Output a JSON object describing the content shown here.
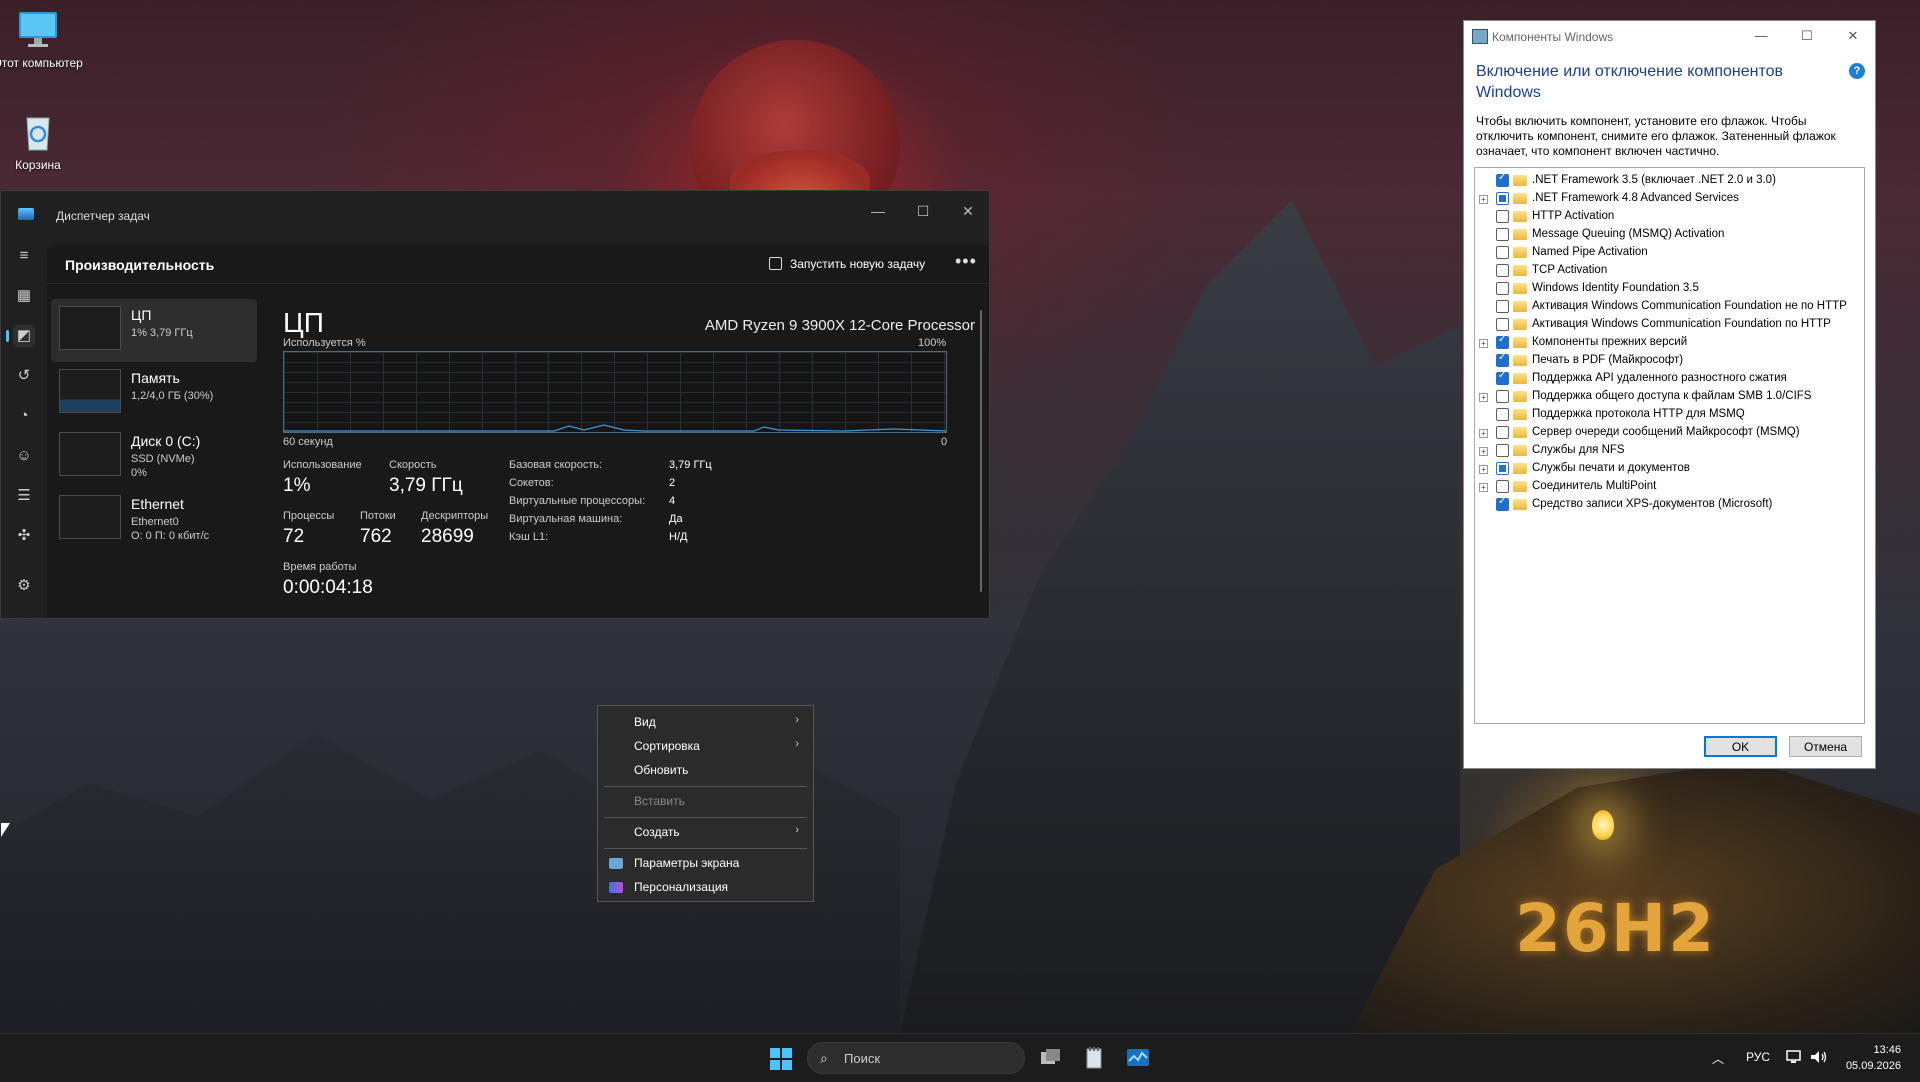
{
  "desktop": {
    "icons": [
      {
        "label": "Этот компьютер"
      },
      {
        "label": "Корзина"
      }
    ],
    "wallpaper_text": "26H2"
  },
  "task_manager": {
    "title": "Диспетчер задач",
    "section_title": "Производительность",
    "run_task_label": "Запустить новую задачу",
    "more_label": "•••",
    "resources": [
      {
        "name": "ЦП",
        "sub1": "1% 3,79 ГГц",
        "sub2": ""
      },
      {
        "name": "Память",
        "sub1": "1,2/4,0 ГБ (30%)",
        "sub2": ""
      },
      {
        "name": "Диск 0 (C:)",
        "sub1": "SSD (NVMe)",
        "sub2": "0%"
      },
      {
        "name": "Ethernet",
        "sub1": "Ethernet0",
        "sub2": "О: 0 П: 0 кбит/с"
      }
    ],
    "detail": {
      "title": "ЦП",
      "processor": "AMD Ryzen 9 3900X 12-Core Processor",
      "graph_label": "Используется %",
      "graph_max": "100%",
      "graph_time": "60 секунд",
      "graph_min": "0",
      "stats": {
        "usage_label": "Использование",
        "usage_value": "1%",
        "speed_label": "Скорость",
        "speed_value": "3,79 ГГц",
        "proc_label": "Процессы",
        "proc_value": "72",
        "threads_label": "Потоки",
        "threads_value": "762",
        "handles_label": "Дескрипторы",
        "handles_value": "28699",
        "uptime_label": "Время работы",
        "uptime_value": "0:00:04:18"
      },
      "kv": [
        {
          "k": "Базовая скорость:",
          "v": "3,79 ГГц"
        },
        {
          "k": "Сокетов:",
          "v": "2"
        },
        {
          "k": "Виртуальные процессоры:",
          "v": "4"
        },
        {
          "k": "Виртуальная машина:",
          "v": "Да"
        },
        {
          "k": "Кэш L1:",
          "v": "Н/Д"
        }
      ]
    },
    "window_controls": {
      "minimize": "—",
      "maximize": "☐",
      "close": "✕"
    }
  },
  "context_menu": {
    "items": [
      {
        "label": "Вид",
        "submenu": true,
        "disabled": false
      },
      {
        "label": "Сортировка",
        "submenu": true,
        "disabled": false
      },
      {
        "label": "Обновить",
        "submenu": false,
        "disabled": false
      },
      {
        "label": "Вставить",
        "submenu": false,
        "disabled": true
      },
      {
        "label": "Создать",
        "submenu": true,
        "disabled": false
      },
      {
        "label": "Параметры экрана",
        "submenu": false,
        "disabled": false
      },
      {
        "label": "Персонализация",
        "submenu": false,
        "disabled": false
      }
    ],
    "arrow": "›"
  },
  "features_dialog": {
    "title": "Компоненты Windows",
    "heading": "Включение или отключение компонентов Windows",
    "help": "?",
    "description": "Чтобы включить компонент, установите его флажок. Чтобы отключить компонент, снимите его флажок. Затененный флажок означает, что компонент включен частично.",
    "items": [
      {
        "label": ".NET Framework 3.5 (включает .NET 2.0 и 3.0)",
        "state": "on",
        "expandable": false
      },
      {
        "label": ".NET Framework 4.8 Advanced Services",
        "state": "partial",
        "expandable": true
      },
      {
        "label": "HTTP Activation",
        "state": "off",
        "expandable": false
      },
      {
        "label": "Message Queuing (MSMQ) Activation",
        "state": "off",
        "expandable": false
      },
      {
        "label": "Named Pipe Activation",
        "state": "off",
        "expandable": false
      },
      {
        "label": "TCP Activation",
        "state": "off",
        "expandable": false
      },
      {
        "label": "Windows Identity Foundation 3.5",
        "state": "off",
        "expandable": false
      },
      {
        "label": "Активация Windows Communication Foundation не по HTTP",
        "state": "off",
        "expandable": false
      },
      {
        "label": "Активация Windows Communication Foundation по HTTP",
        "state": "off",
        "expandable": false
      },
      {
        "label": "Компоненты прежних версий",
        "state": "on",
        "expandable": true
      },
      {
        "label": "Печать в PDF (Майкрософт)",
        "state": "on",
        "expandable": false
      },
      {
        "label": "Поддержка API удаленного разностного сжатия",
        "state": "on",
        "expandable": false
      },
      {
        "label": "Поддержка общего доступа к файлам SMB 1.0/CIFS",
        "state": "off",
        "expandable": true
      },
      {
        "label": "Поддержка протокола HTTP для MSMQ",
        "state": "off",
        "expandable": false
      },
      {
        "label": "Сервер очереди сообщений Майкрософт (MSMQ)",
        "state": "off",
        "expandable": true
      },
      {
        "label": "Службы для NFS",
        "state": "off",
        "expandable": true
      },
      {
        "label": "Службы печати и документов",
        "state": "partial",
        "expandable": true
      },
      {
        "label": "Соединитель MultiPoint",
        "state": "off",
        "expandable": true
      },
      {
        "label": "Средство записи XPS-документов (Microsoft)",
        "state": "on",
        "expandable": false
      }
    ],
    "ok_label": "OK",
    "cancel_label": "Отмена",
    "window_controls": {
      "minimize": "—",
      "maximize": "☐",
      "close": "✕"
    }
  },
  "taskbar": {
    "search_placeholder": "Поиск",
    "language": "РУС",
    "time": "13:46",
    "date": "05.09.2026",
    "tray_chevron": "︿"
  }
}
